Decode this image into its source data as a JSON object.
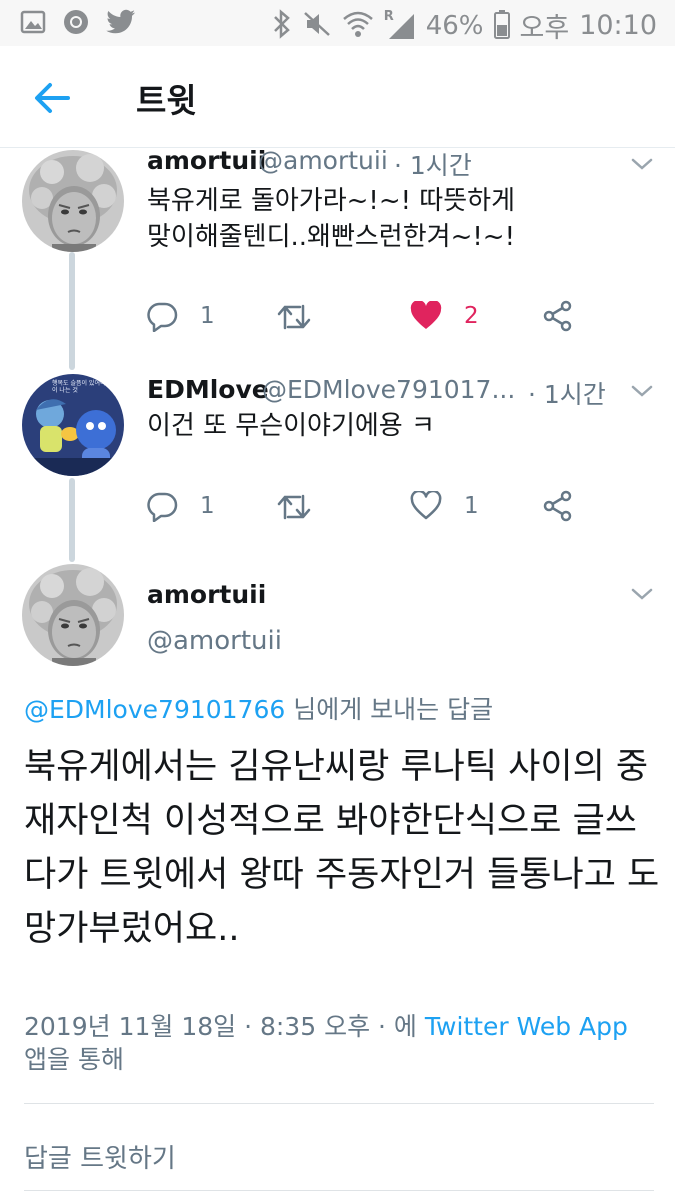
{
  "status_bar": {
    "battery": "46%",
    "ampm": "오후",
    "time": "10:10",
    "signal_letter": "R"
  },
  "header": {
    "title": "트윗"
  },
  "tweets": [
    {
      "name": "amortuii",
      "handle": "@amortuii",
      "time": "· 1시간",
      "lines": [
        "북유게로 돌아가라~!~! 따뜻하게",
        "맞이해줄텐디..왜빤스런한겨~!~!"
      ],
      "reply_count": "1",
      "like_count": "2",
      "liked": true
    },
    {
      "name": "EDMlove",
      "handle": "@EDMlove791017...",
      "time": "· 1시간",
      "lines": [
        "이건 또 무슨이야기에용 ㅋ"
      ],
      "reply_count": "1",
      "like_count": "1",
      "liked": false,
      "avatar_text": "행복도 슬픔이 있어야 빛이 나는 것"
    }
  ],
  "main_tweet": {
    "name": "amortuii",
    "handle": "@amortuii",
    "reply_to_handle": "@EDMlove79101766",
    "reply_to_suffix": " 님에게 보내는 답글",
    "text": "북유게에서는 김유난씨랑 루나틱 사이의 중재자인척 이성적으로 봐야한단식으로 글쓰다가 트윗에서 왕따 주동자인거 들통나고 도망가부렀어요..",
    "meta_prefix": "2019년 11월 18일 · 8:35 오후 · 에 ",
    "meta_app": "Twitter Web App",
    "meta_suffix": "앱을 통해"
  },
  "reply_bar": {
    "placeholder": "답글 트윗하기"
  },
  "colors": {
    "accent": "#1da1f2",
    "like": "#e0245e",
    "secondary_text": "#657786",
    "thread_line": "#ccd6dd"
  }
}
